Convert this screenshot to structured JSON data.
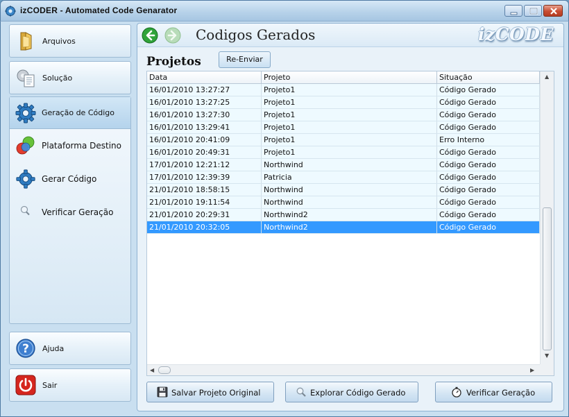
{
  "window": {
    "title": "izCODER - Automated Code Genarator"
  },
  "sidebar": {
    "top_buttons": [
      {
        "label": "Arquivos",
        "icon": "folder-icon"
      },
      {
        "label": "Solução",
        "icon": "solution-icon"
      }
    ],
    "panel": {
      "header": {
        "label": "Geração de Código",
        "icon": "gear-icon"
      },
      "items": [
        {
          "label": "Plataforma Destino",
          "icon": "platform-icon"
        },
        {
          "label": "Gerar Código",
          "icon": "gear-icon"
        },
        {
          "label": "Verificar Geração",
          "icon": "magnifier-icon"
        }
      ]
    },
    "bottom_buttons": [
      {
        "label": "Ajuda",
        "icon": "help-icon"
      },
      {
        "label": "Sair",
        "icon": "power-icon"
      }
    ]
  },
  "main": {
    "title": "Codigos Gerados",
    "brand": "izCODE",
    "section_title": "Projetos",
    "reenviar_label": "Re-Enviar",
    "grid": {
      "columns": [
        "Data",
        "Projeto",
        "Situação"
      ],
      "rows": [
        [
          "16/01/2010 13:27:27",
          "Projeto1",
          "Código Gerado"
        ],
        [
          "16/01/2010 13:27:25",
          "Projeto1",
          "Código Gerado"
        ],
        [
          "16/01/2010 13:27:30",
          "Projeto1",
          "Código Gerado"
        ],
        [
          "16/01/2010 13:29:41",
          "Projeto1",
          "Código Gerado"
        ],
        [
          "16/01/2010 20:41:09",
          "Projeto1",
          "Erro Interno"
        ],
        [
          "16/01/2010 20:49:31",
          "Projeto1",
          "Código Gerado"
        ],
        [
          "17/01/2010 12:21:12",
          "Northwind",
          "Código Gerado"
        ],
        [
          "17/01/2010 12:39:39",
          "Patricia",
          "Código Gerado"
        ],
        [
          "21/01/2010 18:58:15",
          "Northwind",
          "Código Gerado"
        ],
        [
          "21/01/2010 19:11:54",
          "Northwind",
          "Código Gerado"
        ],
        [
          "21/01/2010 20:29:31",
          "Northwind2",
          "Código Gerado"
        ],
        [
          "21/01/2010 20:32:05",
          "Northwind2",
          "Código Gerado"
        ]
      ],
      "selected_row": 11
    },
    "actions": [
      {
        "label": "Salvar Projeto Original",
        "icon": "floppy-disk-icon"
      },
      {
        "label": "Explorar Código Gerado",
        "icon": "magnifier-icon"
      },
      {
        "label": "Verificar Geração",
        "icon": "stopwatch-icon"
      }
    ]
  }
}
